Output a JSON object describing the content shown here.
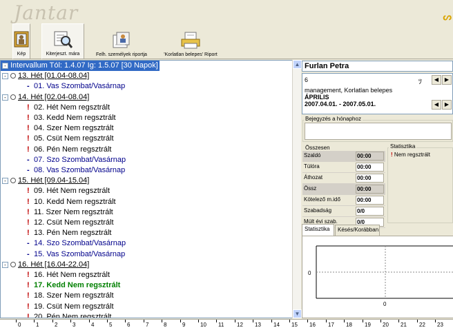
{
  "app": {
    "logo": "Jantar"
  },
  "toolbar": {
    "buttons": [
      {
        "label": "Kép"
      },
      {
        "label": "Kiterjeszt. mára"
      },
      {
        "label": "Felh. személyek riportja"
      },
      {
        "label": "'Korlatlan belepes' Riport"
      }
    ]
  },
  "tree": {
    "header": "Intervallum Tól: 1.4.07 Ig: 1.5.07 [30 Napok]",
    "rows": [
      {
        "kind": "week",
        "text": "13. Hét [01.04-08.04]"
      },
      {
        "kind": "blue",
        "text": "01. Vas Szombat/Vasárnap"
      },
      {
        "kind": "week",
        "text": "14. Hét [02.04-08.04]"
      },
      {
        "kind": "red",
        "text": "02. Hét Nem regsztrált"
      },
      {
        "kind": "red",
        "text": "03. Kedd Nem regsztrált"
      },
      {
        "kind": "red",
        "text": "04. Szer Nem regsztrált"
      },
      {
        "kind": "red",
        "text": "05. Csüt Nem regsztrált"
      },
      {
        "kind": "red",
        "text": "06. Pén Nem regsztrált"
      },
      {
        "kind": "blue",
        "text": "07. Szo Szombat/Vasárnap"
      },
      {
        "kind": "blue",
        "text": "08. Vas Szombat/Vasárnap"
      },
      {
        "kind": "week",
        "text": "15. Hét [09.04-15.04]"
      },
      {
        "kind": "red",
        "text": "09. Hét Nem regsztrált"
      },
      {
        "kind": "red",
        "text": "10. Kedd Nem regsztrált"
      },
      {
        "kind": "red",
        "text": "11. Szer Nem regsztrált"
      },
      {
        "kind": "red",
        "text": "12. Csüt Nem regsztrált"
      },
      {
        "kind": "red",
        "text": "13. Pén Nem regsztrált"
      },
      {
        "kind": "blue",
        "text": "14. Szo Szombat/Vasárnap"
      },
      {
        "kind": "blue",
        "text": "15. Vas Szombat/Vasárnap"
      },
      {
        "kind": "week",
        "text": "16. Hét [16.04-22.04]"
      },
      {
        "kind": "red",
        "text": "16. Hét Nem regsztrált"
      },
      {
        "kind": "green",
        "text": "17. Kedd Nem regsztrált"
      },
      {
        "kind": "red",
        "text": "18. Szer Nem regsztrált"
      },
      {
        "kind": "red",
        "text": "19. Csüt Nem regsztrált"
      },
      {
        "kind": "red",
        "text": "20. Pén Nem regsztrált"
      }
    ]
  },
  "person": {
    "name": "Furlan Petra",
    "id": "6",
    "roles": "management, Korlatlan belepes",
    "month": "ÁPRILIS",
    "range": "2007.04.01. - 2007.05.01."
  },
  "note_group": {
    "label": "Bejegyzés a hónaphoz"
  },
  "summary": {
    "label": "Összesen",
    "rows": [
      {
        "label": "Szaldó",
        "value": "00:00",
        "hl": true
      },
      {
        "label": "Túlóra",
        "value": "00:00",
        "hl": false
      },
      {
        "label": "Áthozat",
        "value": "00:00",
        "hl": false
      },
      {
        "label": "Össz",
        "value": "00:00",
        "hl": true
      },
      {
        "label": "Kötelező m.idő",
        "value": "00:00",
        "hl": false
      },
      {
        "label": "Szabadság",
        "value": "0/0",
        "hl": false
      },
      {
        "label": "Múlt évi szab.",
        "value": "0/0",
        "hl": false
      }
    ]
  },
  "stats": {
    "label": "Statisztika",
    "item": "Nem regsztrált"
  },
  "tabs": [
    {
      "label": "Statisztika",
      "active": true
    },
    {
      "label": "Késés/Korábban",
      "active": false
    }
  ],
  "chart": {
    "y_tick": "0",
    "x_tick": "0"
  },
  "ruler": {
    "ticks": [
      "0",
      "1",
      "2",
      "3",
      "4",
      "5",
      "6",
      "7",
      "8",
      "9",
      "10",
      "11",
      "12",
      "13",
      "14",
      "15",
      "16",
      "17",
      "18",
      "19",
      "20",
      "21",
      "22",
      "23"
    ]
  },
  "colors": {
    "selection": "#316ac5",
    "red_mark": "#c00000",
    "blue_mark": "#00008b",
    "green_text": "#008000"
  }
}
